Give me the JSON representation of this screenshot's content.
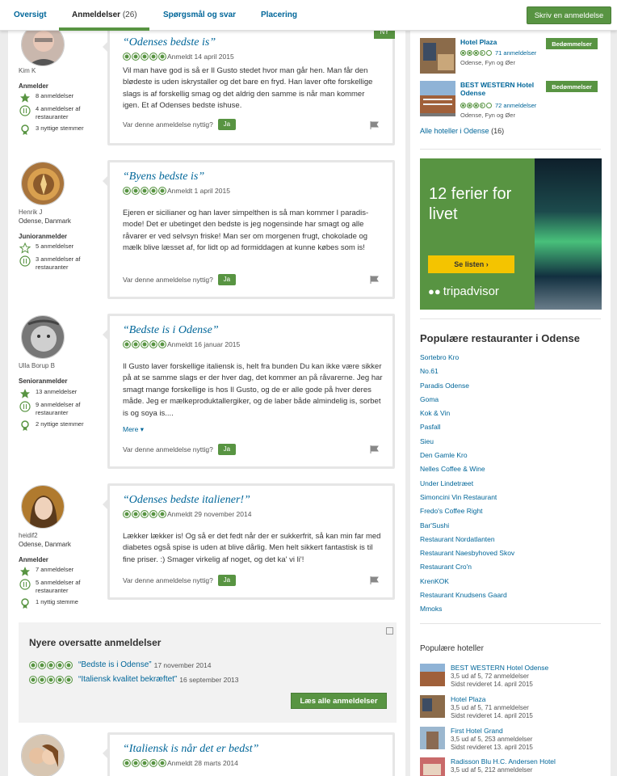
{
  "nav": {
    "tabs": [
      {
        "label": "Oversigt",
        "count": ""
      },
      {
        "label": "Anmeldelser",
        "count": "(26)"
      },
      {
        "label": "Spørgsmål og svar",
        "count": ""
      },
      {
        "label": "Placering",
        "count": ""
      }
    ],
    "write_review": "Skriv en anmeldelse"
  },
  "reviews": [
    {
      "reviewer": "Kim K",
      "location": "",
      "level": "Anmelder",
      "stats": [
        "8 anmeldelser",
        "4 anmeldelser af restauranter",
        "3 nyttige stemmer"
      ],
      "title": "“Odenses bedste is”",
      "rating": 5,
      "date": "Anmeldt 14 april 2015",
      "badge": "NY",
      "body": "Vil man have god is så er Il Gusto stedet hvor man går hen. Man får den bløde­ste is uden iskrystaller og det bare en fryd. Han laver ofte forskellige slags is af forskellig smag og det aldrig den samme is når man kommer igen. Et af Odenses bedste ishuse.",
      "more": "",
      "helpful": "Var denne anmeldelse nyttig?",
      "yes": "Ja"
    },
    {
      "reviewer": "Henrik J",
      "location": "Odense, Danmark",
      "level": "Junioranmelder",
      "stats": [
        "5 anmeldelser",
        "3 anmeldelser af restauranter"
      ],
      "title": "“Byens bedste is”",
      "rating": 5,
      "date": "Anmeldt 1 april 2015",
      "badge": "",
      "body": "Ejeren er sicilianer og han laver simpelthen is så man kommer I paradis-mode! Det er ubetinget den bedste is jeg nogensinde har smagt og alle råvarer er ved selvsyn friske! Man ser om morgenen frugt, chokolade og mælk blive læsset af, for lidt op ad formiddagen at kunne købes som is!",
      "more": "",
      "helpful": "Var denne anmeldelse nyttig?",
      "yes": "Ja"
    },
    {
      "reviewer": "Ulla Borup B",
      "location": "",
      "level": "Senioranmelder",
      "stats": [
        "13 anmeldelser",
        "9 anmeldelser af restauranter",
        "2 nyttige stemmer"
      ],
      "title": "“Bedste is i Odense”",
      "rating": 5,
      "date": "Anmeldt 16 januar 2015",
      "badge": "",
      "body": "Il Gusto laver forskellige italiensk is, helt fra bunden Du kan ikke være sikker på at se samme slags er der hver dag, det kommer an på råvarerne. Jeg har smagt mange forskellige is hos Il Gusto, og de er alle gode på hver deres måde. Jeg er mælkeproduktallergiker, og de laber både almindelig is, sorbet is og soya is....",
      "more": "Mere",
      "helpful": "Var denne anmeldelse nyttig?",
      "yes": "Ja"
    },
    {
      "reviewer": "heidif2",
      "location": "Odense, Danmark",
      "level": "Anmelder",
      "stats": [
        "7 anmeldelser",
        "5 anmeldelser af restauranter",
        "1 nyttig stemme"
      ],
      "title": "“Odenses bedste italiener!”",
      "rating": 5,
      "date": "Anmeldt 29 november 2014",
      "badge": "",
      "body": "Lækker lækker is! Og så er det fedt når der er sukkerfrit, så kan min far med diabetes også spise is uden at blive dårlig. Men helt sikkert fantastisk is til fine priser. :) Smager virkelig af noget, og det ka' vi li'!",
      "more": "",
      "helpful": "Var denne anmeldelse nyttig?",
      "yes": "Ja"
    },
    {
      "reviewer": "",
      "location": "",
      "level": "",
      "stats": [],
      "title": "“Italiensk is når det er bedst”",
      "rating": 5,
      "date": "Anmeldt 28 marts 2014",
      "badge": "",
      "body": "",
      "more": "",
      "helpful": "",
      "yes": ""
    }
  ],
  "translated": {
    "title": "Nyere oversatte anmeldelser",
    "items": [
      {
        "title": "“Bedste is i Odense”",
        "date": "17 november 2014",
        "rating": 5
      },
      {
        "title": "“Italiensk kvalitet bekræftet”",
        "date": "16 september 2013",
        "rating": 5
      }
    ],
    "button": "Læs alle anmeldelser"
  },
  "sidebar": {
    "hotels": [
      {
        "name": "Hotel Plaza",
        "rating": 3.5,
        "reviews": "71 anmeldelser",
        "location": "Odense, Fyn og Øer",
        "button": "Bedømmelser"
      },
      {
        "name": "BEST WESTERN Hotel Odense",
        "rating": 3.5,
        "reviews": "72 anmeldelser",
        "location": "Odense, Fyn og Øer",
        "button": "Bedømmelser"
      }
    ],
    "all_hotels": "Alle hoteller i Odense",
    "all_hotels_count": "(16)",
    "ad": {
      "text": "12 ferier for livet",
      "button": "Se listen",
      "logo": "tripadvisor"
    },
    "popular_restaurants_title": "Populære restauranter i Odense",
    "popular_restaurants": [
      "Sortebro Kro",
      "No.61",
      "Paradis Odense",
      "Goma",
      "Kok & Vin",
      "Pasfall",
      "Sieu",
      "Den Gamle Kro",
      "Nelles Coffee & Wine",
      "Under Lindetræet",
      "Simoncini Vin Restaurant",
      "Fredo's Coffee Right",
      "Bar'Sushi",
      "Restaurant Nordatlanten",
      "Restaurant Naesbyhoved Skov",
      "Restaurant Cro'n",
      "KrenKOK",
      "Restaurant Knudsens Gaard",
      "Mmoks"
    ],
    "popular_hotels_title": "Populære hoteller",
    "popular_hotels": [
      {
        "name": "BEST WESTERN Hotel Odense",
        "rating": "3,5 ud af 5, 72 anmeldelser",
        "revised": "Sidst revideret 14. april 2015"
      },
      {
        "name": "Hotel Plaza",
        "rating": "3,5 ud af 5, 71 anmeldelser",
        "revised": "Sidst revideret 14. april 2015"
      },
      {
        "name": "First Hotel Grand",
        "rating": "3,5 ud af 5, 253 anmeldelser",
        "revised": "Sidst revideret 13. april 2015"
      },
      {
        "name": "Radisson Blu H.C. Andersen Hotel",
        "rating": "3,5 ud af 5, 212 anmeldelser",
        "revised": ""
      }
    ]
  },
  "colors": {
    "accent": "#589442",
    "link": "#006699",
    "ad_yellow": "#f4c400"
  }
}
